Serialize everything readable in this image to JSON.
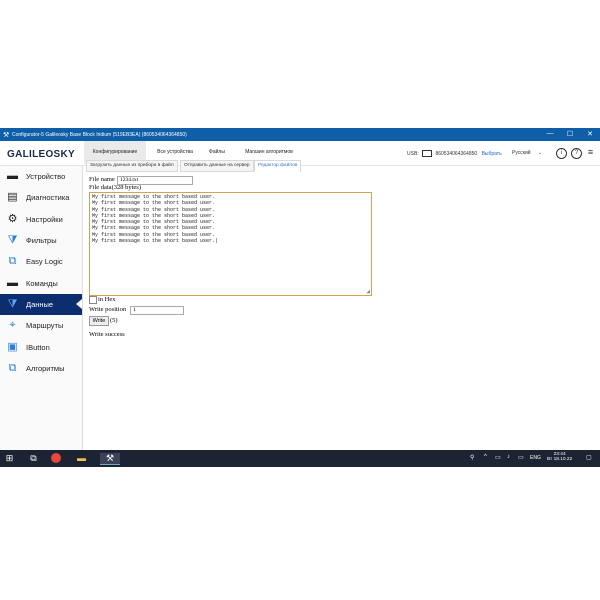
{
  "window": {
    "title": "Configurator-5 Galileosky Base Block Iridium (519EB3EA) (860534064364850)",
    "app_icon": "tools-icon",
    "controls": [
      "—",
      "☐",
      "✕"
    ]
  },
  "header": {
    "logo": "GALILEOSKY",
    "tabs": [
      {
        "label": "Конфигурирование",
        "active": true
      },
      {
        "label": "Все устройства",
        "active": false
      },
      {
        "label": "Файлы",
        "active": false
      },
      {
        "label": "Магазин алгоритмов",
        "active": false
      }
    ],
    "usb_label": "USB:",
    "device_id": "860534064364850",
    "pick_label": "Выбрать",
    "language": "Русский",
    "right_icons": [
      "info-icon",
      "help-icon",
      "menu-icon"
    ]
  },
  "sidebar": {
    "items": [
      {
        "label": "Устройство",
        "icon": "device-icon",
        "active": false
      },
      {
        "label": "Диагностика",
        "icon": "diagnostics-icon",
        "active": false
      },
      {
        "label": "Настройки",
        "icon": "settings-icon",
        "active": false
      },
      {
        "label": "Фильтры",
        "icon": "filters-icon",
        "active": false
      },
      {
        "label": "Easy Logic",
        "icon": "easy-logic-icon",
        "active": false
      },
      {
        "label": "Команды",
        "icon": "commands-icon",
        "active": false
      },
      {
        "label": "Данные",
        "icon": "data-icon",
        "active": true
      },
      {
        "label": "Маршруты",
        "icon": "routes-icon",
        "active": false
      },
      {
        "label": "IButton",
        "icon": "ibutton-icon",
        "active": false
      },
      {
        "label": "Алгоритмы",
        "icon": "algorithms-icon",
        "active": false
      }
    ]
  },
  "subtabs": [
    {
      "label": "Загрузить данные из прибора в файл",
      "active": false
    },
    {
      "label": "Отправить данные на сервер",
      "active": false
    },
    {
      "label": "Редактор файлов",
      "active": true
    }
  ],
  "editor": {
    "file_name_label": "File name",
    "file_name_value": "1234.txt",
    "file_data_label": "File data(328 bytes)",
    "lines": [
      "My first message to the short based user.",
      "My first message to the short based user.",
      "My first message to the short based user.",
      "My first message to the short based user.",
      "My first message to the short based user.",
      "My first message to the short based user.",
      "My first message to the short based user.",
      "My first message to the short based user.|"
    ],
    "in_hex_label": "in Hex",
    "in_hex_checked": false,
    "write_position_label": "Write position",
    "write_position_value": "1",
    "write_button_label": "Write",
    "write_count": "(5)",
    "status_text": "Write success"
  },
  "taskbar": {
    "apps": [
      "windows-start-icon",
      "task-view-icon",
      "chrome-icon",
      "file-explorer-icon",
      "configurator-icon"
    ],
    "language": "ENG",
    "time": "23:44",
    "date": "Вт 18.10.22"
  }
}
